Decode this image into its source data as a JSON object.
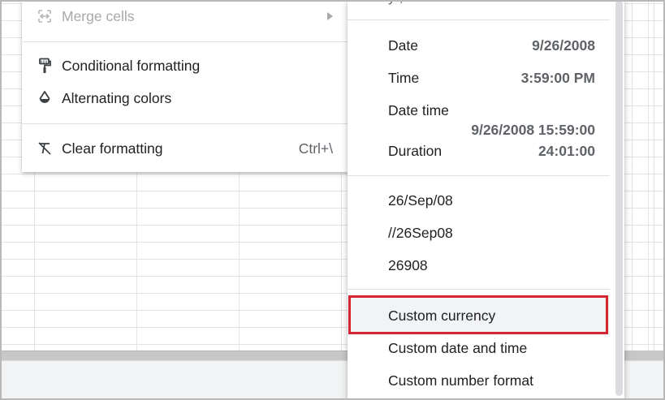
{
  "colors": {
    "highlight_border": "#d62530",
    "hover_bg": "#f1f3f4",
    "menu_text": "#202124",
    "disabled_text": "#a8a8a8",
    "value_text": "#5f6368"
  },
  "format_menu": {
    "items": [
      {
        "label": "Merge cells",
        "icon": "merge-cells-icon",
        "disabled": true,
        "has_submenu": true
      },
      {
        "label": "Conditional formatting",
        "icon": "paint-roller-icon"
      },
      {
        "label": "Alternating colors",
        "icon": "color-drop-icon"
      },
      {
        "label": "Clear formatting",
        "icon": "clear-format-icon",
        "shortcut": "Ctrl+\\"
      }
    ]
  },
  "number_submenu": {
    "partial_top": "y                              ,",
    "datetime": [
      {
        "label": "Date",
        "value": "9/26/2008"
      },
      {
        "label": "Time",
        "value": "3:59:00 PM"
      },
      {
        "label": "Date time",
        "value": "9/26/2008 15:59:00"
      },
      {
        "label": "Duration",
        "value": "24:01:00"
      }
    ],
    "recent": [
      "26/Sep/08",
      "//26Sep08",
      "26908"
    ],
    "custom": [
      {
        "label": "Custom currency",
        "highlighted": true
      },
      {
        "label": "Custom date and time"
      },
      {
        "label": "Custom number format"
      }
    ]
  }
}
